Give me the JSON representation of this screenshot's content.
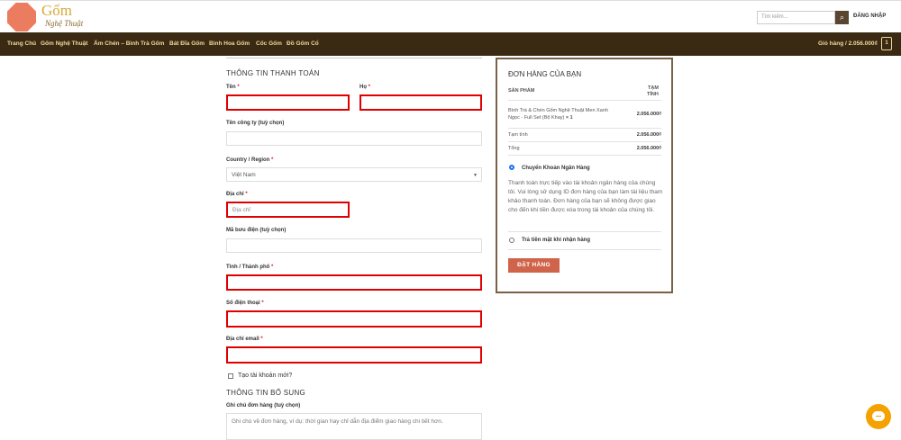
{
  "logo": {
    "line1": "Gốm",
    "line2": "Nghệ Thuật"
  },
  "header": {
    "search_placeholder": "Tìm kiếm...",
    "search_icon": "magnifier-icon",
    "login_label": "ĐĂNG NHẬP"
  },
  "nav": {
    "items": [
      "Trang Chủ",
      "Gốm Nghệ Thuật",
      "Ấm Chén – Bình Trà Gốm",
      "Bát Đĩa Gốm",
      "Bình Hoa Gốm",
      "Cốc Gốm",
      "Đồ Gốm Cổ"
    ],
    "cart_label": "Giỏ hàng / 2.056.000₫",
    "cart_count": "1"
  },
  "billing": {
    "title": "THÔNG TIN THANH TOÁN",
    "first_name_label": "Tên",
    "last_name_label": "Họ",
    "company_label": "Tên công ty (tuỳ chọn)",
    "country_label": "Country / Region",
    "country_value": "Việt Nam",
    "address_label": "Địa chỉ",
    "address_placeholder": "Địa chỉ",
    "postcode_label": "Mã bưu điện (tuỳ chọn)",
    "city_label": "Tỉnh / Thành phố",
    "phone_label": "Số điện thoại",
    "email_label": "Địa chỉ email",
    "required_mark": "*",
    "create_account_label": "Tạo tài khoản mới?"
  },
  "additional": {
    "title": "THÔNG TIN BỔ SUNG",
    "notes_label": "Ghi chú đơn hàng (tuỳ chọn)",
    "notes_placeholder": "Ghi chú về đơn hàng, ví dụ: thời gian hay chỉ dẫn địa điểm giao hàng chi tiết hơn."
  },
  "order": {
    "title": "ĐƠN HÀNG CỦA BẠN",
    "col_product": "SẢN PHẨM",
    "col_subtotal_1": "TẠM",
    "col_subtotal_2": "TÍNH",
    "item_name_1": "Bình Trà & Chén Gốm Nghệ Thuật Men Xanh",
    "item_name_2": "Ngọc - Full Set (Bộ Khay)",
    "item_qty": "× 1",
    "item_price": "2.056.000₫",
    "subtotal_label": "Tạm tính",
    "subtotal_value": "2.056.000₫",
    "total_label": "Tổng",
    "total_value": "2.056.000₫",
    "payment_bank_label": "Chuyển Khoản Ngân Hàng",
    "payment_bank_desc": "Thanh toán trực tiếp vào tài khoản ngân hàng của chúng tôi. Vui lòng sử dụng ID đơn hàng của bạn làm tài liệu tham khảo thanh toán. Đơn hàng của bạn sẽ không được giao cho đến khi tiền được xóa trong tài khoản của chúng tôi.",
    "payment_cod_label": "Trả tiền mặt khi nhận hàng",
    "place_order_label": "ĐẶT HÀNG"
  },
  "colors": {
    "nav_bg": "#3a2a14",
    "nav_text": "#f2d79a",
    "error_border": "#e00000",
    "button": "#d0644a",
    "chat": "#f5a100"
  }
}
